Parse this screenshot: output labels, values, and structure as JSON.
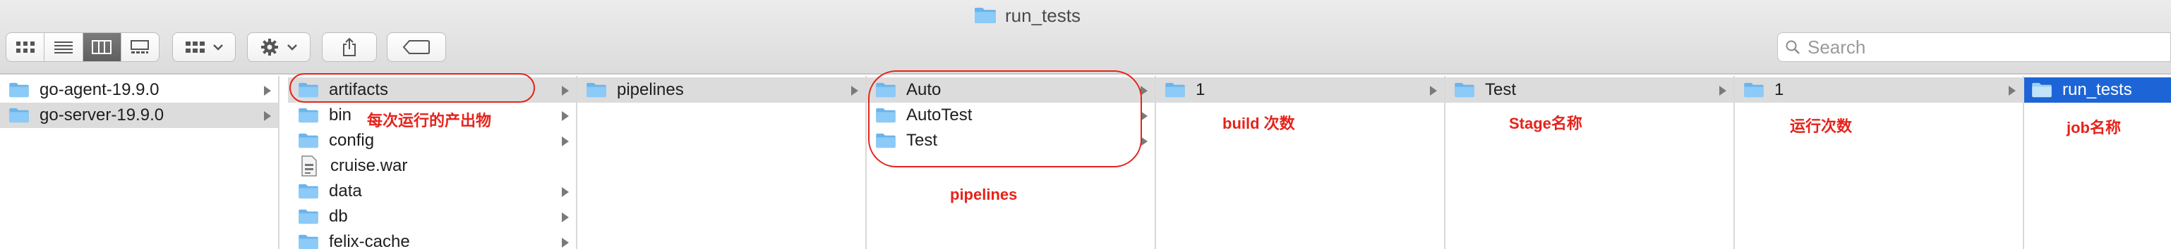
{
  "window": {
    "title": "run_tests"
  },
  "toolbar": {
    "view_modes": [
      "icon-view-icon",
      "list-view-icon",
      "column-view-icon",
      "gallery-view-icon"
    ],
    "group_icon": "group-by-icon",
    "action_icon": "gear-icon",
    "share_icon": "share-icon",
    "tag_icon": "tag-icon",
    "search_placeholder": "Search"
  },
  "columns": [
    {
      "items": [
        {
          "label": "go-agent-19.9.0",
          "type": "folder",
          "arrow": true,
          "selected": false
        },
        {
          "label": "go-server-19.9.0",
          "type": "folder",
          "arrow": true,
          "selected": true
        }
      ]
    },
    {
      "items": [
        {
          "label": "artifacts",
          "type": "folder",
          "arrow": true,
          "selected": true
        },
        {
          "label": "bin",
          "type": "folder",
          "arrow": true,
          "selected": false
        },
        {
          "label": "config",
          "type": "folder",
          "arrow": true,
          "selected": false
        },
        {
          "label": "cruise.war",
          "type": "file",
          "arrow": false,
          "selected": false
        },
        {
          "label": "data",
          "type": "folder",
          "arrow": true,
          "selected": false
        },
        {
          "label": "db",
          "type": "folder",
          "arrow": true,
          "selected": false
        },
        {
          "label": "felix-cache",
          "type": "folder",
          "arrow": true,
          "selected": false
        }
      ]
    },
    {
      "items": [
        {
          "label": "pipelines",
          "type": "folder",
          "arrow": true,
          "selected": true
        }
      ]
    },
    {
      "items": [
        {
          "label": "Auto",
          "type": "folder",
          "arrow": true,
          "selected": true
        },
        {
          "label": "AutoTest",
          "type": "folder",
          "arrow": true,
          "selected": false
        },
        {
          "label": "Test",
          "type": "folder",
          "arrow": true,
          "selected": false
        }
      ]
    },
    {
      "items": [
        {
          "label": "1",
          "type": "folder",
          "arrow": true,
          "selected": true
        }
      ]
    },
    {
      "items": [
        {
          "label": "Test",
          "type": "folder",
          "arrow": true,
          "selected": true
        }
      ]
    },
    {
      "items": [
        {
          "label": "1",
          "type": "folder",
          "arrow": true,
          "selected": true
        }
      ]
    },
    {
      "items": [
        {
          "label": "run_tests",
          "type": "folder",
          "arrow": false,
          "selected": true,
          "active": true
        }
      ]
    }
  ],
  "annotations": {
    "artifacts": "每次运行的产出物",
    "pipelines": "pipelines",
    "build": "build 次数",
    "stage": "Stage名称",
    "run": "运行次数",
    "job": "job名称"
  },
  "colors": {
    "annotation": "#e5231b",
    "selection_blue": "#1d65d6",
    "selection_gray": "#dcdcdc",
    "folder": "#6cb4ec"
  }
}
